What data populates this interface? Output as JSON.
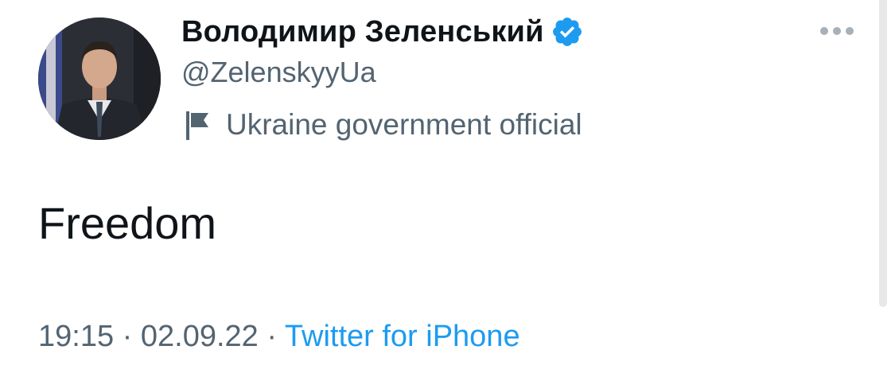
{
  "tweet": {
    "author": {
      "display_name": "Володимир Зеленський",
      "handle": "@ZelenskyyUa",
      "verified": true,
      "label": "Ukraine government official"
    },
    "text": "Freedom",
    "time": "19:15",
    "separator": "·",
    "date": "02.09.22",
    "source": "Twitter for iPhone"
  },
  "icons": {
    "verified": "verified-badge-icon",
    "label": "flag-icon",
    "more": "more-options-icon"
  },
  "colors": {
    "primary_text": "#0f1419",
    "secondary_text": "#536471",
    "link": "#1d9bf0",
    "verified": "#1d9bf0"
  }
}
